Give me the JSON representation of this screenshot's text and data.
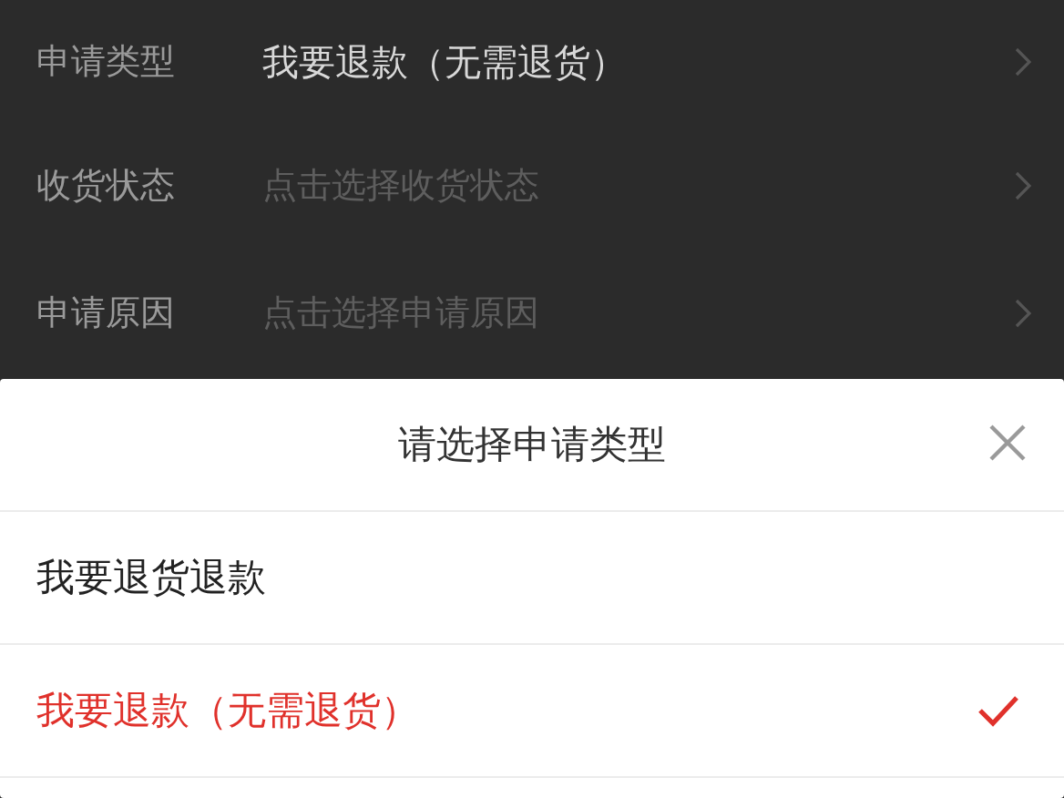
{
  "form_rows": [
    {
      "label": "申请类型",
      "value": "我要退款（无需退货）"
    },
    {
      "label": "收货状态",
      "placeholder": "点击选择收货状态"
    },
    {
      "label": "申请原因",
      "placeholder": "点击选择申请原因"
    }
  ],
  "sheet": {
    "title": "请选择申请类型",
    "options": [
      {
        "label": "我要退货退款",
        "selected": false
      },
      {
        "label": "我要退款（无需退货）",
        "selected": true
      }
    ]
  }
}
